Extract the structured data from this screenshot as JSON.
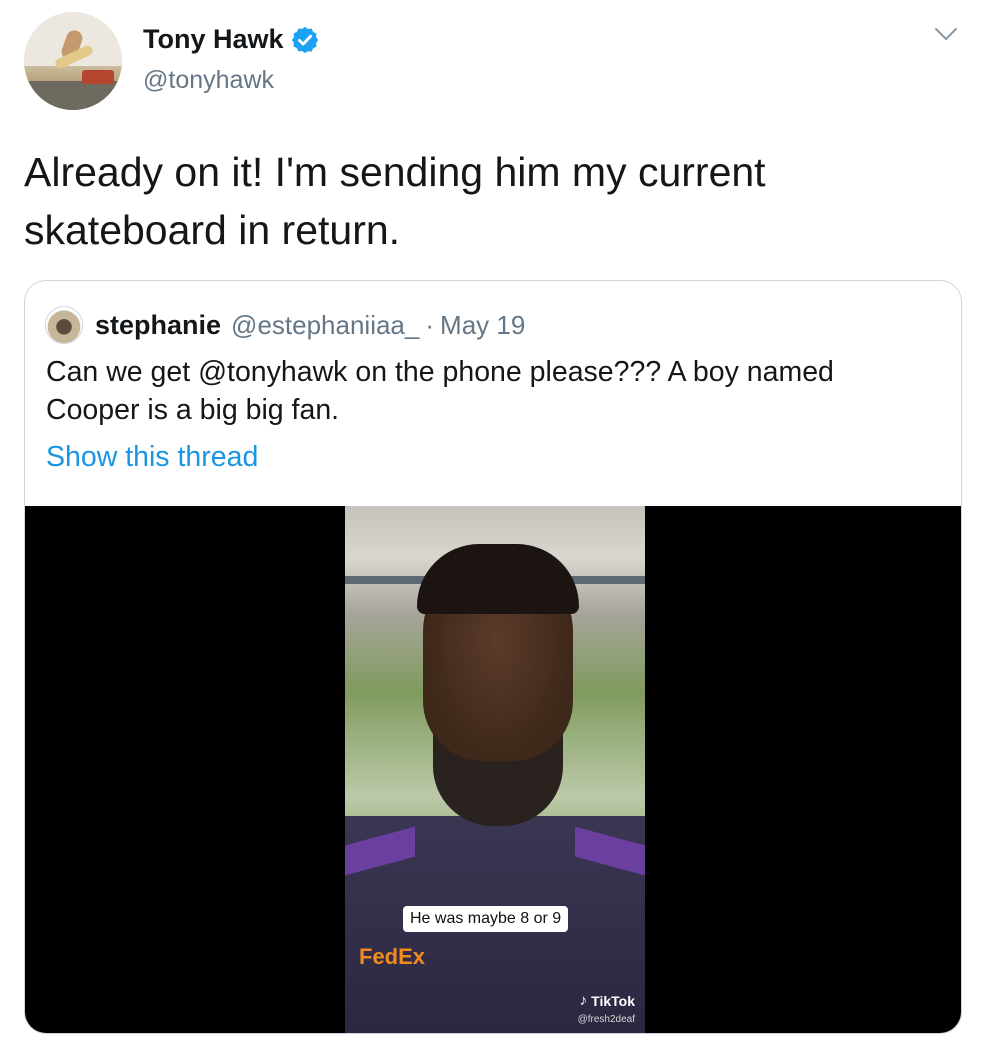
{
  "author": {
    "name": "Tony Hawk",
    "handle": "@tonyhawk"
  },
  "tweet": {
    "text": "Already on it! I'm sending him my current skateboard in return."
  },
  "quoted": {
    "name": "stephanie",
    "handle": "@estephaniiaa_",
    "separator": "·",
    "date": "May 19",
    "text": "Can we get @tonyhawk on the phone please??? A boy named Cooper is a big big fan.",
    "show_thread": "Show this thread"
  },
  "video": {
    "caption": "He was maybe 8 or 9",
    "watermark_brand": "TikTok",
    "watermark_user": "@fresh2deaf",
    "shirt_logo": "FedEx"
  },
  "colors": {
    "link": "#1b95e0",
    "verified": "#1da1f2",
    "muted": "#657786",
    "border": "#ccd6dd"
  }
}
